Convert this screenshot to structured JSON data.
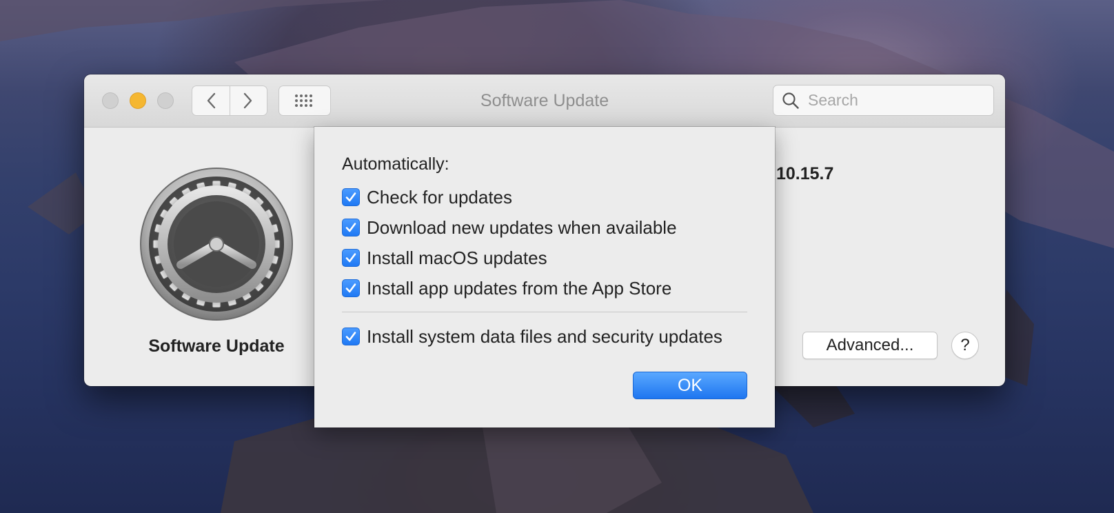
{
  "window": {
    "title": "Software Update",
    "search_placeholder": "Search"
  },
  "pane": {
    "name": "Software Update",
    "version_fragment": "10.15.7",
    "advanced_label": "Advanced...",
    "help_label": "?"
  },
  "sheet": {
    "heading": "Automatically:",
    "options": [
      {
        "label": "Check for updates",
        "checked": true
      },
      {
        "label": "Download new updates when available",
        "checked": true
      },
      {
        "label": "Install macOS updates",
        "checked": true
      },
      {
        "label": "Install app updates from the App Store",
        "checked": true
      },
      {
        "label": "Install system data files and security updates",
        "checked": true
      }
    ],
    "ok_label": "OK"
  },
  "colors": {
    "accent": "#1f79f4",
    "minimize": "#f5b731"
  },
  "icons": [
    "back-chevron-icon",
    "forward-chevron-icon",
    "grid-icon",
    "search-icon",
    "gear-icon",
    "checkmark-icon"
  ]
}
